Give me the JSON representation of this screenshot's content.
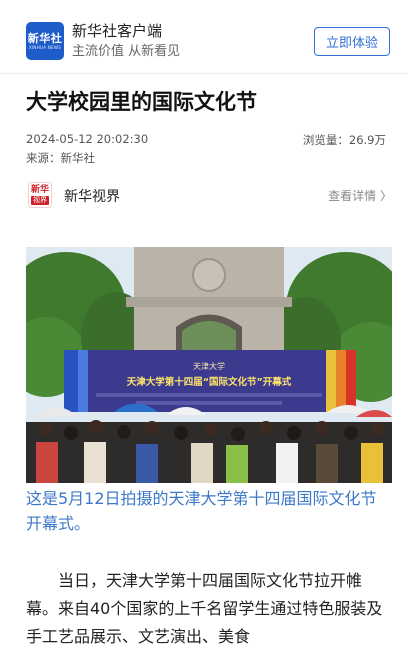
{
  "app": {
    "logo_text": "新华社",
    "logo_sub": "XINHUA NEWS",
    "name": "新华社客户端",
    "slogan": "主流价值 从新看见",
    "cta_label": "立即体验"
  },
  "article": {
    "title": "大学校园里的国际文化节",
    "datetime": "2024-05-12 20:02:30",
    "source": "来源：新华社",
    "views": "浏览量：26.9万",
    "channel_logo_top": "新华",
    "channel_logo_bottom": "视界",
    "channel_name": "新华视界",
    "channel_more": "查看详情 〉",
    "image_banner_title": "天津大学第十四届“国际文化节”开幕式",
    "image_banner_top": "天津大学",
    "caption": "这是5月12日拍摄的天津大学第十四届国际文化节开幕式。",
    "body": "当日，天津大学第十四届国际文化节拉开帷幕。来自40个国家的上千名留学生通过特色服装及手工艺品展示、文艺演出、美食"
  },
  "colors": {
    "brand_blue": "#1d5cc9",
    "link_blue": "#2f6fd6",
    "caption_blue": "#3c79c9"
  }
}
